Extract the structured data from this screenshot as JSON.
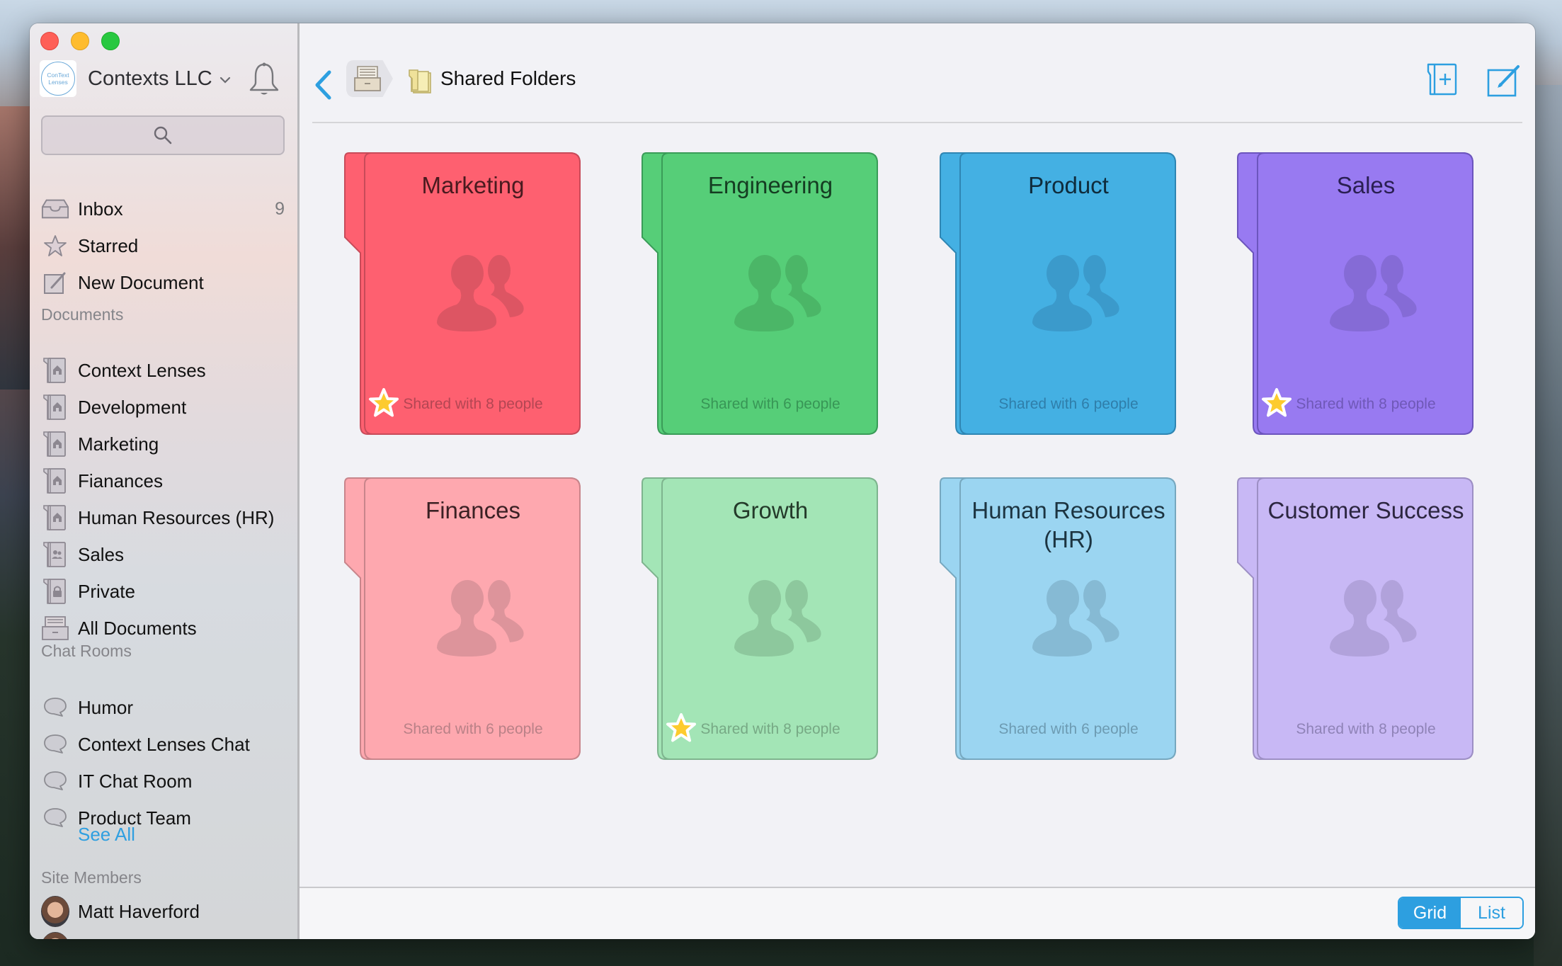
{
  "window": {
    "org": {
      "name": "Contexts LLC",
      "logo_text_1": "ConText",
      "logo_text_2": "Lenses"
    }
  },
  "sidebar": {
    "search_placeholder": "",
    "top_items": [
      {
        "label": "Inbox",
        "icon": "inbox-icon",
        "count": "9"
      },
      {
        "label": "Starred",
        "icon": "star-icon"
      },
      {
        "label": "New Document",
        "icon": "compose-icon"
      }
    ],
    "documents_header": "Documents",
    "documents": [
      {
        "label": "Context Lenses",
        "icon": "home-folder-icon"
      },
      {
        "label": "Development",
        "icon": "home-folder-icon"
      },
      {
        "label": "Marketing",
        "icon": "home-folder-icon"
      },
      {
        "label": "Fianances",
        "icon": "home-folder-icon"
      },
      {
        "label": "Human Resources (HR)",
        "icon": "home-folder-icon"
      },
      {
        "label": "Sales",
        "icon": "shared-folder-icon"
      },
      {
        "label": "Private",
        "icon": "lock-folder-icon"
      },
      {
        "label": "All Documents",
        "icon": "archive-icon"
      }
    ],
    "chat_header": "Chat Rooms",
    "chat_rooms": [
      {
        "label": "Humor"
      },
      {
        "label": "Context Lenses Chat"
      },
      {
        "label": "IT Chat Room"
      },
      {
        "label": "Product Team"
      }
    ],
    "see_all": "See All",
    "members_header": "Site Members",
    "members": [
      {
        "name": "Matt Haverford"
      }
    ]
  },
  "header": {
    "breadcrumb_title": "Shared Folders"
  },
  "folders": [
    {
      "title": "Marketing",
      "shared": "Shared with 8 people",
      "starred": true,
      "color": "#fe6070",
      "border": "#c84b59",
      "text": "#4a1a1f",
      "icon": "#dd5563",
      "sub": "#b34653"
    },
    {
      "title": "Engineering",
      "shared": "Shared with 6 people",
      "starred": false,
      "color": "#56ce78",
      "border": "#3a9c58",
      "text": "#153d22",
      "icon": "#4bb667",
      "sub": "#389656"
    },
    {
      "title": "Product",
      "shared": "Shared with 6 people",
      "starred": false,
      "color": "#44b0e3",
      "border": "#2f86b3",
      "text": "#0f2c3c",
      "icon": "#3b9acb",
      "sub": "#2f7eaa"
    },
    {
      "title": "Sales",
      "shared": "Shared with 8 people",
      "starred": true,
      "color": "#987af1",
      "border": "#6c55bd",
      "text": "#2a1f52",
      "icon": "#856bd6",
      "sub": "#6f58b7"
    },
    {
      "title": "Finances",
      "shared": "Shared with 6 people",
      "starred": false,
      "color": "#fea8af",
      "border": "#c8858b",
      "text": "#3b2124",
      "icon": "#dd949b",
      "sub": "#b98187"
    },
    {
      "title": "Growth",
      "shared": "Shared with 8 people",
      "starred": true,
      "color": "#a3e5b6",
      "border": "#7eb48e",
      "text": "#243a2a",
      "icon": "#8dc89d",
      "sub": "#77a985"
    },
    {
      "title": "Human Resources (HR)",
      "shared": "Shared with 6 people",
      "starred": false,
      "color": "#9bd5f1",
      "border": "#77a8bf",
      "text": "#1c3441",
      "icon": "#86bad4",
      "sub": "#6d9bb2"
    },
    {
      "title": "Customer Success",
      "shared": "Shared with 8 people",
      "starred": false,
      "color": "#c8b8f5",
      "border": "#9d8fc4",
      "text": "#2c2640",
      "icon": "#b1a2db",
      "sub": "#8f83b7"
    }
  ],
  "view_toggle": {
    "grid": "Grid",
    "list": "List",
    "selected": "Grid"
  },
  "colors": {
    "accent": "#2d9fe0",
    "star": "#fdcb2e"
  }
}
